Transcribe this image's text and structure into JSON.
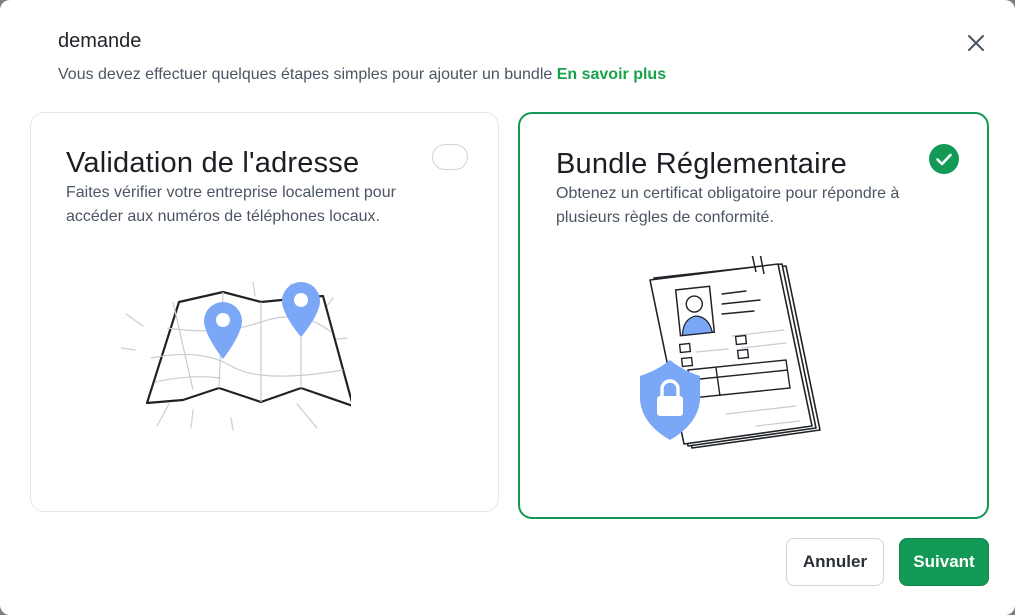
{
  "dialog": {
    "title": "demande",
    "subtitle": "Vous devez effectuer quelques étapes simples pour ajouter un bundle",
    "learn_more": "En savoir plus"
  },
  "options": [
    {
      "title": "Validation de l'adresse",
      "description": "Faites vérifier votre entreprise localement pour accéder aux numéros de téléphones locaux.",
      "selected": false,
      "icon": "map-pins-illustration"
    },
    {
      "title": "Bundle Réglementaire",
      "description": "Obtenez un certificat obligatoire pour répondre à plusieurs règles de conformité.",
      "selected": true,
      "icon": "certificate-document-illustration"
    }
  ],
  "buttons": {
    "cancel": "Annuler",
    "next": "Suivant"
  },
  "colors": {
    "accent": "#129955",
    "link": "#16a34a",
    "illustration_blue": "#7ba7f7"
  }
}
